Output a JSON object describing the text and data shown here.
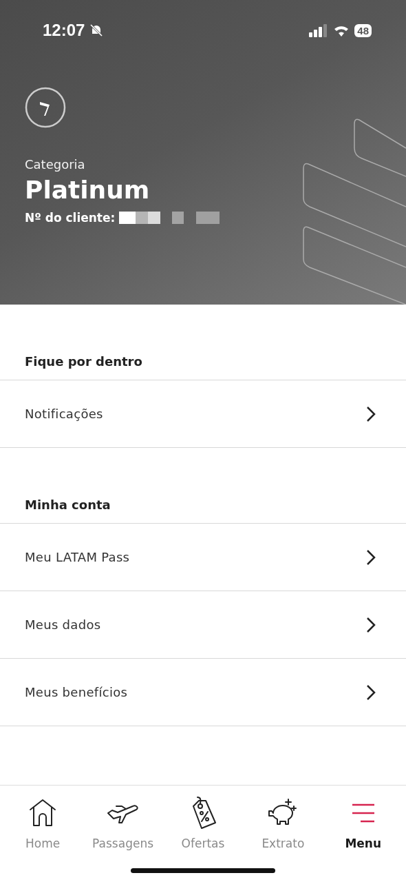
{
  "status_bar": {
    "time": "12:07",
    "battery": "48"
  },
  "profile": {
    "category_label": "Categoria",
    "category": "Platinum",
    "client_label": "Nº do cliente:"
  },
  "sections": [
    {
      "title": "Fique por dentro",
      "items": [
        {
          "label": "Notificações"
        }
      ]
    },
    {
      "title": "Minha conta",
      "items": [
        {
          "label": "Meu LATAM Pass"
        },
        {
          "label": "Meus dados"
        },
        {
          "label": "Meus benefícios"
        }
      ]
    }
  ],
  "tab_bar": [
    {
      "kind": "home",
      "label": "Home",
      "selected": false
    },
    {
      "kind": "plane",
      "label": "Passagens",
      "selected": false
    },
    {
      "kind": "tag",
      "label": "Ofertas",
      "selected": false
    },
    {
      "kind": "piggy",
      "label": "Extrato",
      "selected": false
    },
    {
      "kind": "menu",
      "label": "Menu",
      "selected": true
    }
  ]
}
